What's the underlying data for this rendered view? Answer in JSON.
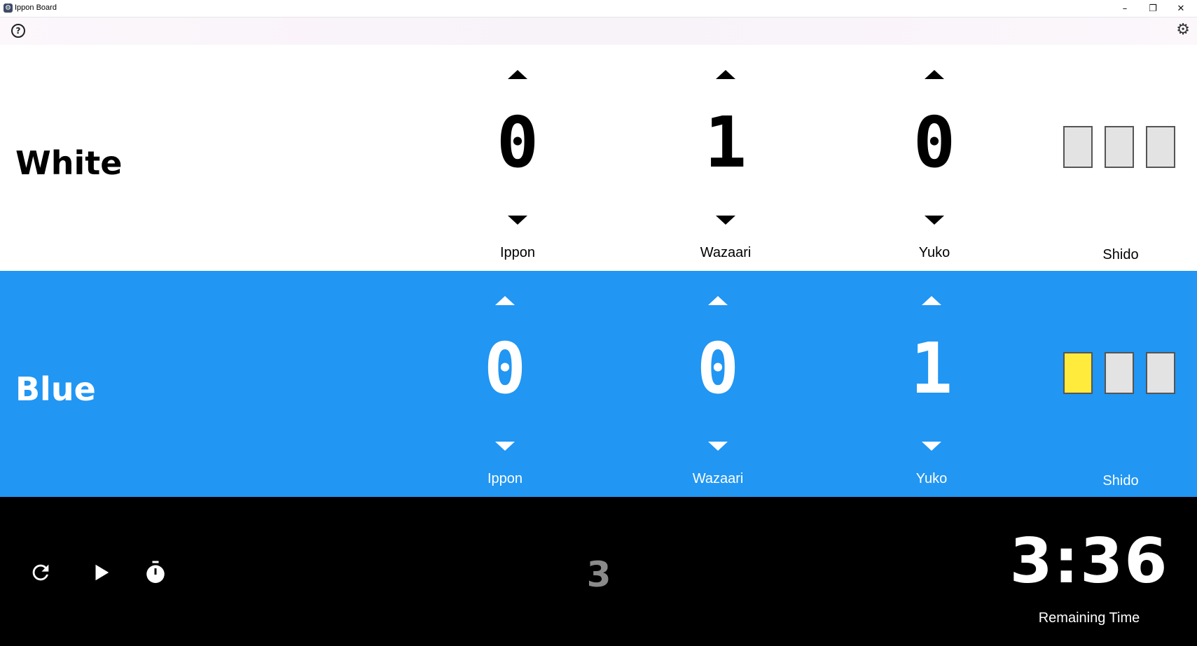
{
  "window": {
    "title": "Ippon Board",
    "minimize_label": "–",
    "restore_label": "❐",
    "close_label": "✕"
  },
  "toolbar": {
    "help_label": "?",
    "settings_icon": "gear-icon"
  },
  "players": [
    {
      "name": "White",
      "bg_color": "#ffffff",
      "text_color": "#000000",
      "ippon": {
        "value": "0",
        "label": "Ippon"
      },
      "wazaari": {
        "value": "1",
        "label": "Wazaari"
      },
      "yuko": {
        "value": "0",
        "label": "Yuko"
      },
      "shido": {
        "label": "Shido",
        "count": 0,
        "max": 3
      }
    },
    {
      "name": "Blue",
      "bg_color": "#2196f3",
      "text_color": "#ffffff",
      "ippon": {
        "value": "0",
        "label": "Ippon"
      },
      "wazaari": {
        "value": "0",
        "label": "Wazaari"
      },
      "yuko": {
        "value": "1",
        "label": "Yuko"
      },
      "shido": {
        "label": "Shido",
        "count": 1,
        "max": 3
      }
    }
  ],
  "controls": {
    "reset_icon": "refresh-icon",
    "play_icon": "play-icon",
    "stopwatch_icon": "stopwatch-icon",
    "osaekomi_count": "3",
    "remaining_time": "3:36",
    "remaining_time_label": "Remaining Time"
  },
  "colors": {
    "blue": "#2196f3",
    "shido_active": "#ffeb3b",
    "shido_inactive": "#e3e3e3"
  }
}
